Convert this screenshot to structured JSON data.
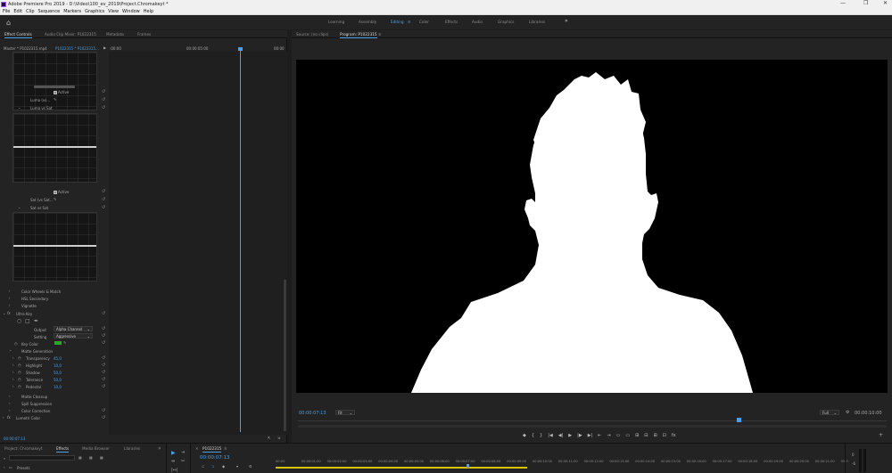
{
  "window": {
    "title": "Adobe Premiere Pro 2019 - D:\\Video\\100_ev_2019\\Project.Chromakeyt *",
    "controls": [
      "—",
      "❐",
      "✕"
    ]
  },
  "menu": [
    "File",
    "Edit",
    "Clip",
    "Sequence",
    "Markers",
    "Graphics",
    "View",
    "Window",
    "Help"
  ],
  "workspaces": {
    "items": [
      "Learning",
      "Assembly",
      "Editing",
      "Color",
      "Effects",
      "Audio",
      "Graphics",
      "Libraries"
    ],
    "active": "Editing",
    "more": "»"
  },
  "effect_controls": {
    "tabs": [
      "Effect Controls",
      "Audio Clip Mixer: P1022315",
      "Metadata",
      "Frames"
    ],
    "source_row": {
      "master": "Master * P1022315.mp4",
      "clip": "P1022315 * P1022315..."
    },
    "timecode_start": ":00:00",
    "timecode_mid": "00:00:05:00",
    "timecode_end": "00:00",
    "active_label": "Active",
    "luma_vs_label": "Luma (vs...",
    "luma_vs_sat": "Luma vs Sat",
    "active2_label": "Active",
    "sat_vs_sat_label": "Sat (vs Sat...",
    "sat_vs_sat": "Sat vs Sat",
    "sections": [
      "Color Wheels & Match",
      "HSL Secondary",
      "Vignette"
    ],
    "ultra_key": "Ultra Key",
    "output_label": "Output",
    "output_value": "Alpha Channel",
    "setting_label": "Setting",
    "setting_value": "Aggressive",
    "key_color_label": "Key Color",
    "key_color": "#2fa42f",
    "matte_generation": "Matte Generation",
    "matte_params": [
      {
        "name": "Transparency",
        "value": "45,0"
      },
      {
        "name": "Highlight",
        "value": "10,0"
      },
      {
        "name": "Shadow",
        "value": "50,0"
      },
      {
        "name": "Tolerance",
        "value": "50,0"
      },
      {
        "name": "Pedestal",
        "value": "10,0"
      }
    ],
    "more_sections": [
      "Matte Cleanup",
      "Spill Suppression",
      "Color Correction"
    ],
    "lumetri": "Lumetri Color",
    "bottom_timecode": "00:00:07:13"
  },
  "program_monitor": {
    "tabs": [
      "Source: (no clips)",
      "Program: P1022315"
    ],
    "timecode": "00:00:07:13",
    "fit": "Fit",
    "quality": "Full",
    "duration": "00:00:10:00",
    "transport": [
      "◆",
      "{",
      "}",
      "|◀",
      "◀|",
      "▶",
      "|▶",
      "▶|",
      "⇤",
      "⇥",
      "▭",
      "▭",
      "⊞",
      "⊟",
      "⊞",
      "⊡",
      "fx"
    ],
    "add": "+"
  },
  "project_panel": {
    "tabs": [
      "Project: Chromakeyt",
      "Effects",
      "Media Browser",
      "Libraries"
    ],
    "presets": "Presets",
    "more": "»"
  },
  "timeline": {
    "sequence": "P1022315",
    "timecode": "00:00:07:13",
    "ruler": [
      "00:00",
      "00:00:01:00",
      "00:00:02:00",
      "00:00:03:00",
      "00:00:04:00",
      "00:00:05:00",
      "00:00:06:00",
      "00:00:07:00",
      "00:00:08:00",
      "00:00:09:00",
      "00:00:10:00",
      "00:00:11:00",
      "00:00:12:00",
      "00:00:13:00",
      "00:00:14:00",
      "00:00:15:00",
      "00:00:16:00",
      "00:00:17:00",
      "00:00:18:00",
      "00:00:19:00",
      "00:00:20:00",
      "00:00:21:00",
      "00:0"
    ]
  },
  "audio_meter": {
    "labels": [
      "0",
      "-6"
    ]
  }
}
